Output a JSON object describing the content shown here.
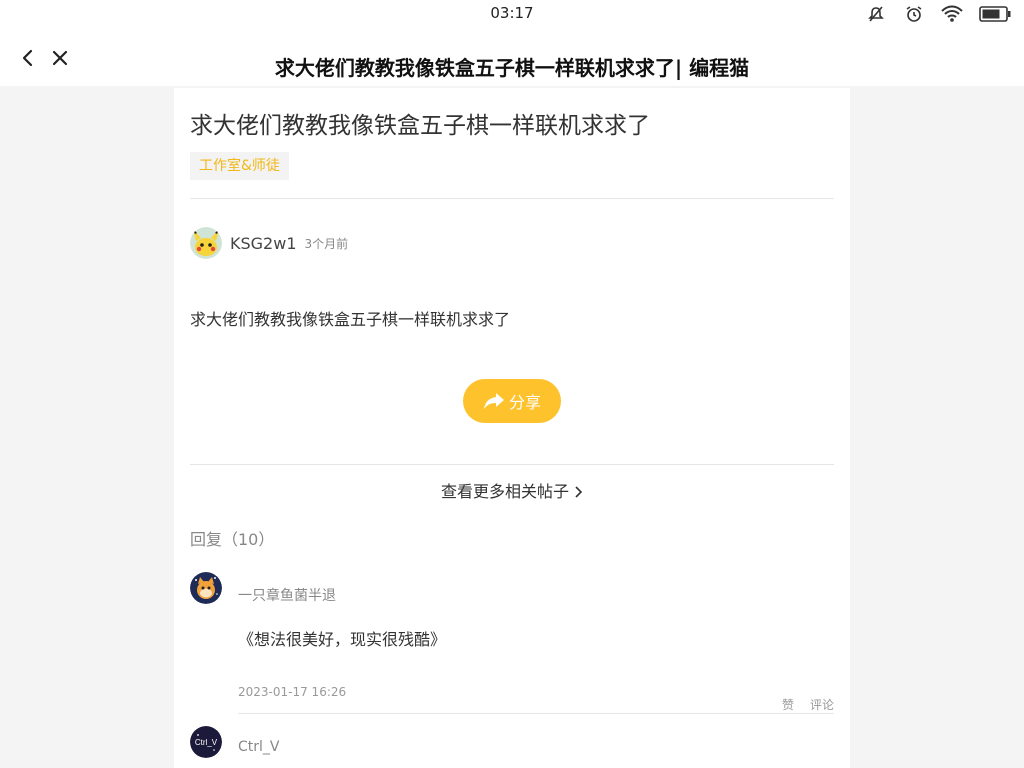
{
  "status_bar": {
    "time": "03:17",
    "icons": [
      "mute-icon",
      "alarm-icon",
      "wifi-icon",
      "battery-icon"
    ]
  },
  "nav": {
    "title": "求大佬们教教我像铁盒五子棋一样联机求求了| 编程猫",
    "icons": [
      "back-icon",
      "close-icon"
    ]
  },
  "post": {
    "title": "求大佬们教教我像铁盒五子棋一样联机求求了",
    "tag": "工作室&师徒",
    "author": "KSG2w1",
    "time": "3个月前",
    "body": "求大佬们教教我像铁盒五子棋一样联机求求了",
    "share_label": "分享",
    "more_label": "查看更多相关帖子"
  },
  "replies": {
    "header": "回复（10）",
    "items": [
      {
        "name": "一只章鱼菌半退",
        "text": "《想法很美好，现实很残酷》",
        "date": "2023-01-17 16:26",
        "like_label": "赞",
        "comment_label": "评论"
      },
      {
        "name": "Ctrl_V",
        "avatar_text": "Ctrl_V"
      }
    ]
  },
  "colors": {
    "accent": "#fec22d",
    "tag_text": "#f2b818",
    "page_bg": "#f4f4f4"
  }
}
